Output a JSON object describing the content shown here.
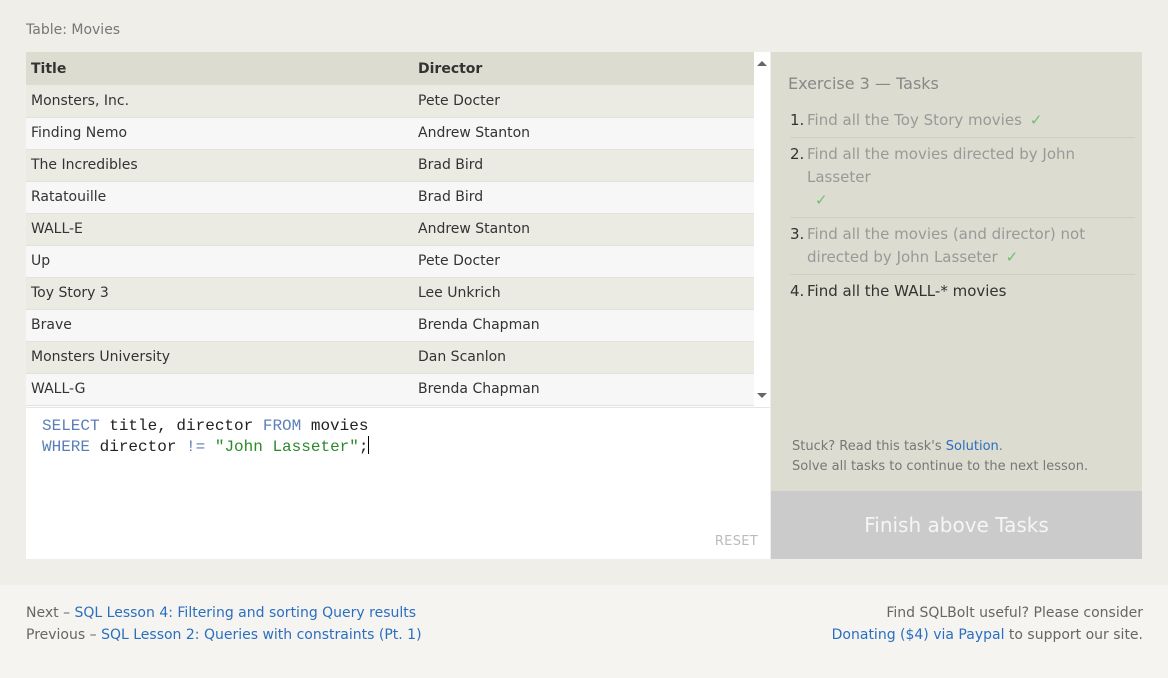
{
  "table_caption": "Table: Movies",
  "results": {
    "columns": [
      "Title",
      "Director"
    ],
    "rows": [
      [
        "Monsters, Inc.",
        "Pete Docter"
      ],
      [
        "Finding Nemo",
        "Andrew Stanton"
      ],
      [
        "The Incredibles",
        "Brad Bird"
      ],
      [
        "Ratatouille",
        "Brad Bird"
      ],
      [
        "WALL-E",
        "Andrew Stanton"
      ],
      [
        "Up",
        "Pete Docter"
      ],
      [
        "Toy Story 3",
        "Lee Unkrich"
      ],
      [
        "Brave",
        "Brenda Chapman"
      ],
      [
        "Monsters University",
        "Dan Scanlon"
      ],
      [
        "WALL-G",
        "Brenda Chapman"
      ]
    ]
  },
  "editor": {
    "line1": {
      "kw1": "SELECT",
      "mid": " title, director ",
      "kw2": "FROM",
      "tail": " movies"
    },
    "line2": {
      "kw1": "WHERE",
      "mid": " director ",
      "op": "!=",
      "sp": " ",
      "str": "\"John Lasseter\"",
      "tail": ";"
    },
    "reset_label": "RESET"
  },
  "tasks": {
    "title": "Exercise 3 — Tasks",
    "items": [
      {
        "num": "1.",
        "text": "Find all the Toy Story movies",
        "done": "✓"
      },
      {
        "num": "2.",
        "text": "Find all the movies directed by John Lasseter",
        "done": "✓"
      },
      {
        "num": "3.",
        "text": "Find all the movies (and director) not directed by John Lasseter",
        "done": "✓"
      },
      {
        "num": "4.",
        "text": "Find all the WALL-* movies",
        "done": ""
      }
    ],
    "stuck_prefix": "Stuck? Read this task's ",
    "solution_link": "Solution",
    "stuck_suffix": ".",
    "continue_text": "Solve all tasks to continue to the next lesson.",
    "finish_button": "Finish above Tasks"
  },
  "footer": {
    "next_prefix": "Next – ",
    "next_link": "SQL Lesson 4: Filtering and sorting Query results",
    "prev_prefix": "Previous – ",
    "prev_link": "SQL Lesson 2: Queries with constraints (Pt. 1)",
    "useful_text": "Find SQLBolt useful? Please consider",
    "donate_link": "Donating ($4) via Paypal",
    "donate_suffix": " to support our site."
  },
  "colors": {
    "keyword": "#5a7fb8",
    "string": "#2a8a2a",
    "link": "#2a6fbf",
    "check": "#6fc06f",
    "tasks_panel": "#dcdcd0",
    "finish_button": "#cbcbcb"
  }
}
